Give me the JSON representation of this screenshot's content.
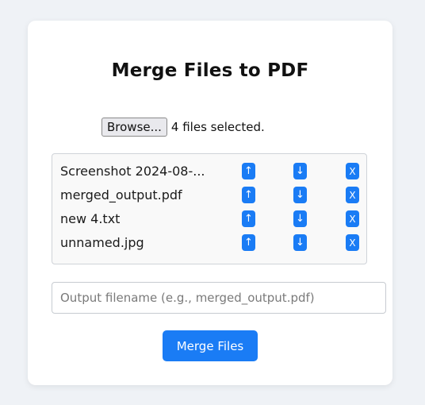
{
  "page": {
    "title": "Merge Files to PDF"
  },
  "file_picker": {
    "browse_label": "Browse...",
    "status": "4 files selected."
  },
  "files": [
    {
      "name": "Screenshot 2024-08-...",
      "up": "↑",
      "down": "↓",
      "remove": "X"
    },
    {
      "name": "merged_output.pdf",
      "up": "↑",
      "down": "↓",
      "remove": "X"
    },
    {
      "name": "new 4.txt",
      "up": "↑",
      "down": "↓",
      "remove": "X"
    },
    {
      "name": "unnamed.jpg",
      "up": "↑",
      "down": "↓",
      "remove": "X"
    }
  ],
  "output": {
    "placeholder": "Output filename (e.g., merged_output.pdf)",
    "value": ""
  },
  "actions": {
    "merge_label": "Merge Files"
  },
  "colors": {
    "accent": "#1a7cf5",
    "background": "#eff2f6",
    "card": "#ffffff",
    "list_bg": "#f9f9f9"
  }
}
